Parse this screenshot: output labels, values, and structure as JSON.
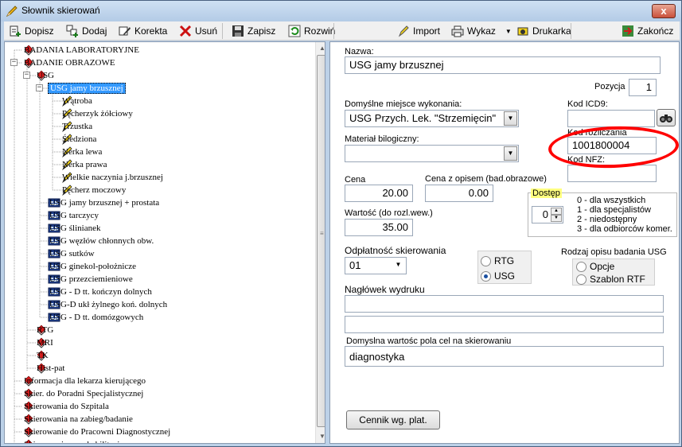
{
  "window": {
    "title": "Słownik skierowań",
    "close_label": "x"
  },
  "toolbar": {
    "dopisz": "Dopisz",
    "dodaj": "Dodaj",
    "korekta": "Korekta",
    "usun": "Usuń",
    "zapisz": "Zapisz",
    "rozwin": "Rozwiń",
    "import": "Import",
    "wykaz": "Wykaz",
    "drukarka": "Drukarka",
    "zakoncz": "Zakończ"
  },
  "tree": {
    "items": [
      {
        "label": "BADANIA LABORATORYJNE"
      },
      {
        "label": "BADANIE OBRAZOWE"
      },
      {
        "label": "USG"
      },
      {
        "label": "USG jamy brzusznej"
      },
      {
        "label": "Wątroba"
      },
      {
        "label": "Pęcherzyk żółciowy"
      },
      {
        "label": "Trzustka"
      },
      {
        "label": "Śledziona"
      },
      {
        "label": "Nerka lewa"
      },
      {
        "label": "Nerka prawa"
      },
      {
        "label": "Wielkie naczynia j.brzusznej"
      },
      {
        "label": "Pęcherz moczowy"
      },
      {
        "label": "USG jamy brzusznej + prostata"
      },
      {
        "label": "USG tarczycy"
      },
      {
        "label": "USG ślinianek"
      },
      {
        "label": "USG węzłów chłonnych obw."
      },
      {
        "label": "USG sutków"
      },
      {
        "label": "USG ginekol-położnicze"
      },
      {
        "label": "USG przezciemieniowe"
      },
      {
        "label": "USG - D tt. kończyn dolnych"
      },
      {
        "label": "USG-D ukł żylnego koń. dolnych"
      },
      {
        "label": "USG - D tt. domózgowych"
      },
      {
        "label": "RTG"
      },
      {
        "label": "MRI"
      },
      {
        "label": "TK"
      },
      {
        "label": "Hist-pat"
      },
      {
        "label": "Informacja dla lekarza kierującego"
      },
      {
        "label": "Skier. do Poradni Specjalistycznej"
      },
      {
        "label": "Skierowania do Szpitala"
      },
      {
        "label": "Skierowania na zabieg/badanie"
      },
      {
        "label": "Skierowanie do Pracowni Diagnostycznej"
      },
      {
        "label": "Skierowania na rehabilitację"
      }
    ]
  },
  "form": {
    "nazwa_label": "Nazwa:",
    "nazwa_value": "USG jamy brzusznej",
    "pozycja_label": "Pozycja",
    "pozycja_value": "1",
    "miejsce_label": "Domyślne miejsce wykonania:",
    "miejsce_value": "USG Przych. Lek. \"Strzemięcin\"",
    "icd9_label": "Kod ICD9:",
    "icd9_value": "",
    "kod_rozl_label": "Kod rozliczania",
    "kod_rozl_value": "1001800004",
    "material_label": "Materiał bilogiczny:",
    "material_value": "",
    "kod_nfz_label": "Kod NFZ:",
    "kod_nfz_value": "",
    "cena_label": "Cena",
    "cena_value": "20.00",
    "cena_opis_label": "Cena z opisem (bad.obrazowe)",
    "cena_opis_value": "0.00",
    "dostep_label": "Dostęp",
    "dostep_value": "0",
    "dostep_notes": [
      "0 - dla wszystkich",
      "1 - dla specjalistów",
      "2 - niedostępny",
      "3 - dla odbiorców komer."
    ],
    "wartosc_label": "Wartość (do rozl.wew.)",
    "wartosc_value": "35.00",
    "odplatnosc_label": "Odpłatność skierowania",
    "odplatnosc_value": "01",
    "rodzaj_rtg": "RTG",
    "rodzaj_usg": "USG",
    "rodzaj_opisu_label": "Rodzaj opisu badania USG",
    "opcje": "Opcje",
    "szablon": "Szablon RTF",
    "naglowek_label": "Nagłówek wydruku",
    "naglowek_1": "",
    "naglowek_2": "",
    "cel_label": "Domyslna wartośc pola cel na skierowaniu",
    "cel_value": "diagnostyka",
    "cennik_button": "Cennik wg. plat."
  }
}
